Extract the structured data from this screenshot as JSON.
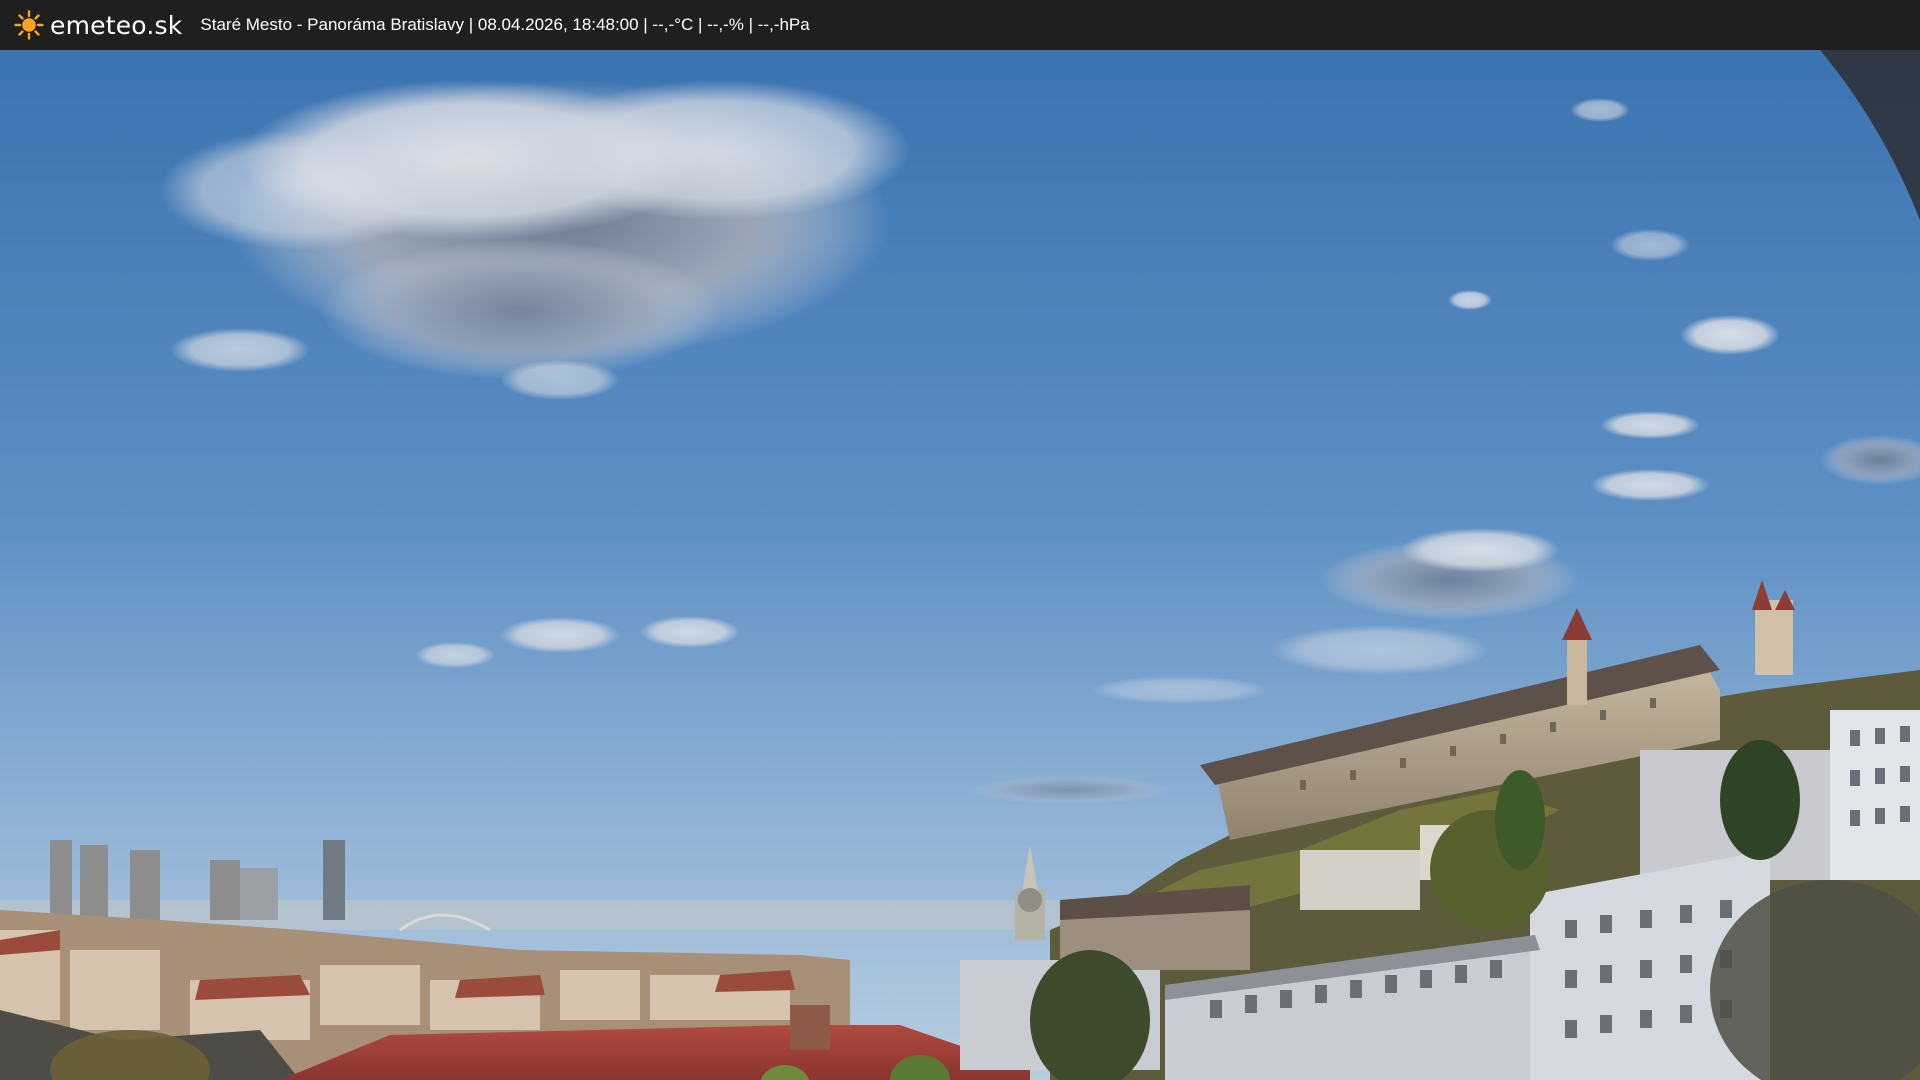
{
  "header": {
    "logo_text": "emeteo.sk",
    "logo_icon": "sun-icon",
    "caption": "Staré Mesto - Panoráma Bratislavy | 08.04.2026, 18:48:00 | --,-°C | --,-% | --,-hPa"
  },
  "colors": {
    "header_bg": "#1f1f1f",
    "sun": "#f5a623",
    "sky_top": "#3f77b4",
    "sky_bottom": "#a9c3dc",
    "roof_red": "#a9443c"
  }
}
